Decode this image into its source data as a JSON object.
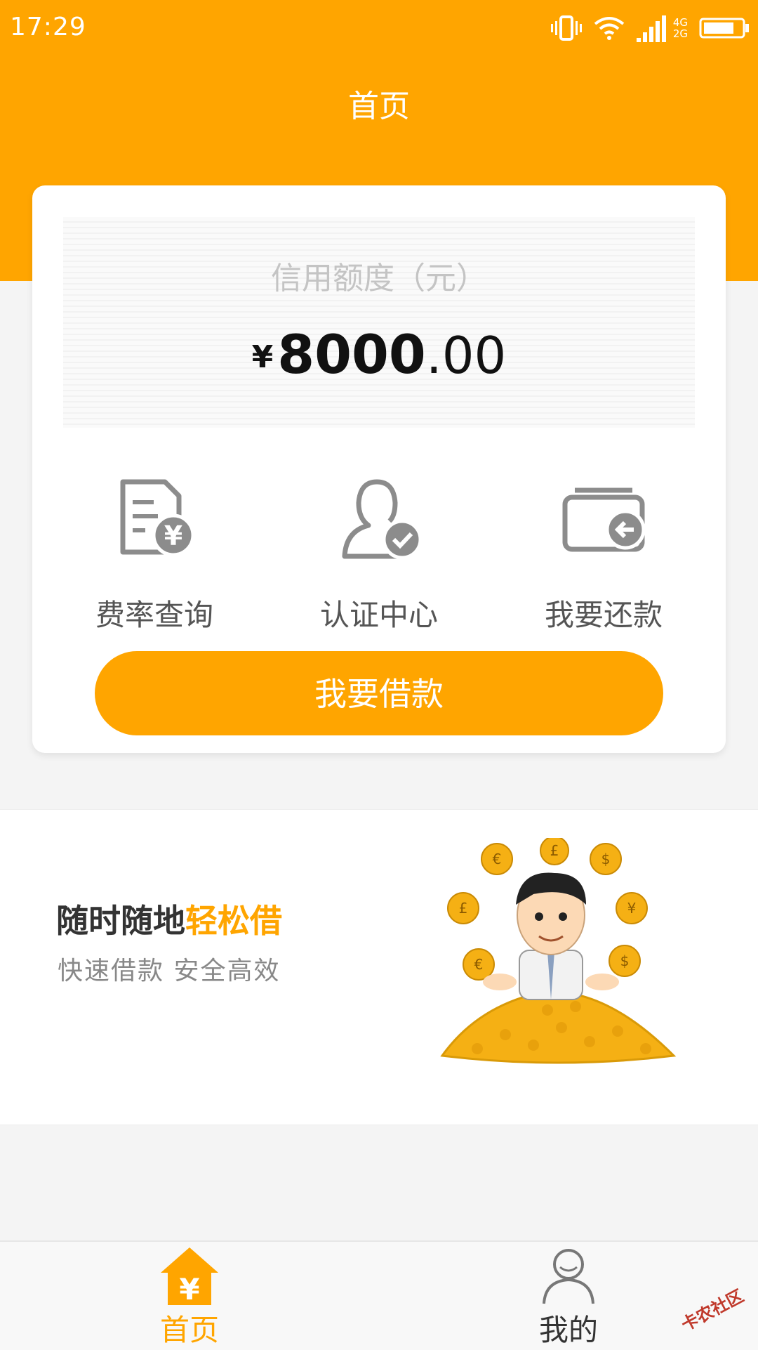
{
  "status_bar": {
    "time": "17:29",
    "network_top": "4G",
    "network_bottom": "2G",
    "icons": [
      "vibrate-icon",
      "wifi-icon",
      "signal-icon",
      "battery-icon"
    ]
  },
  "header": {
    "title": "首页"
  },
  "credit": {
    "label": "信用额度（元）",
    "currency_symbol": "¥",
    "amount_integer": "8000",
    "amount_decimal": ".00"
  },
  "actions": [
    {
      "label": "费率查询",
      "icon": "fee-document-icon"
    },
    {
      "label": "认证中心",
      "icon": "user-verified-icon"
    },
    {
      "label": "我要还款",
      "icon": "wallet-repay-icon"
    }
  ],
  "loan_button": {
    "label": "我要借款"
  },
  "promo": {
    "title_main": "随时随地",
    "title_highlight": "轻松借",
    "subtitle": "快速借款 安全高效"
  },
  "tabbar": {
    "tabs": [
      {
        "label": "首页",
        "icon": "home-yen-icon",
        "active": true
      },
      {
        "label": "我的",
        "icon": "user-icon",
        "active": false
      }
    ]
  },
  "watermark": {
    "text": "卡农社区"
  },
  "colors": {
    "accent": "#ffa500",
    "icon_gray": "#8c8c8c",
    "background": "#f4f4f4"
  }
}
